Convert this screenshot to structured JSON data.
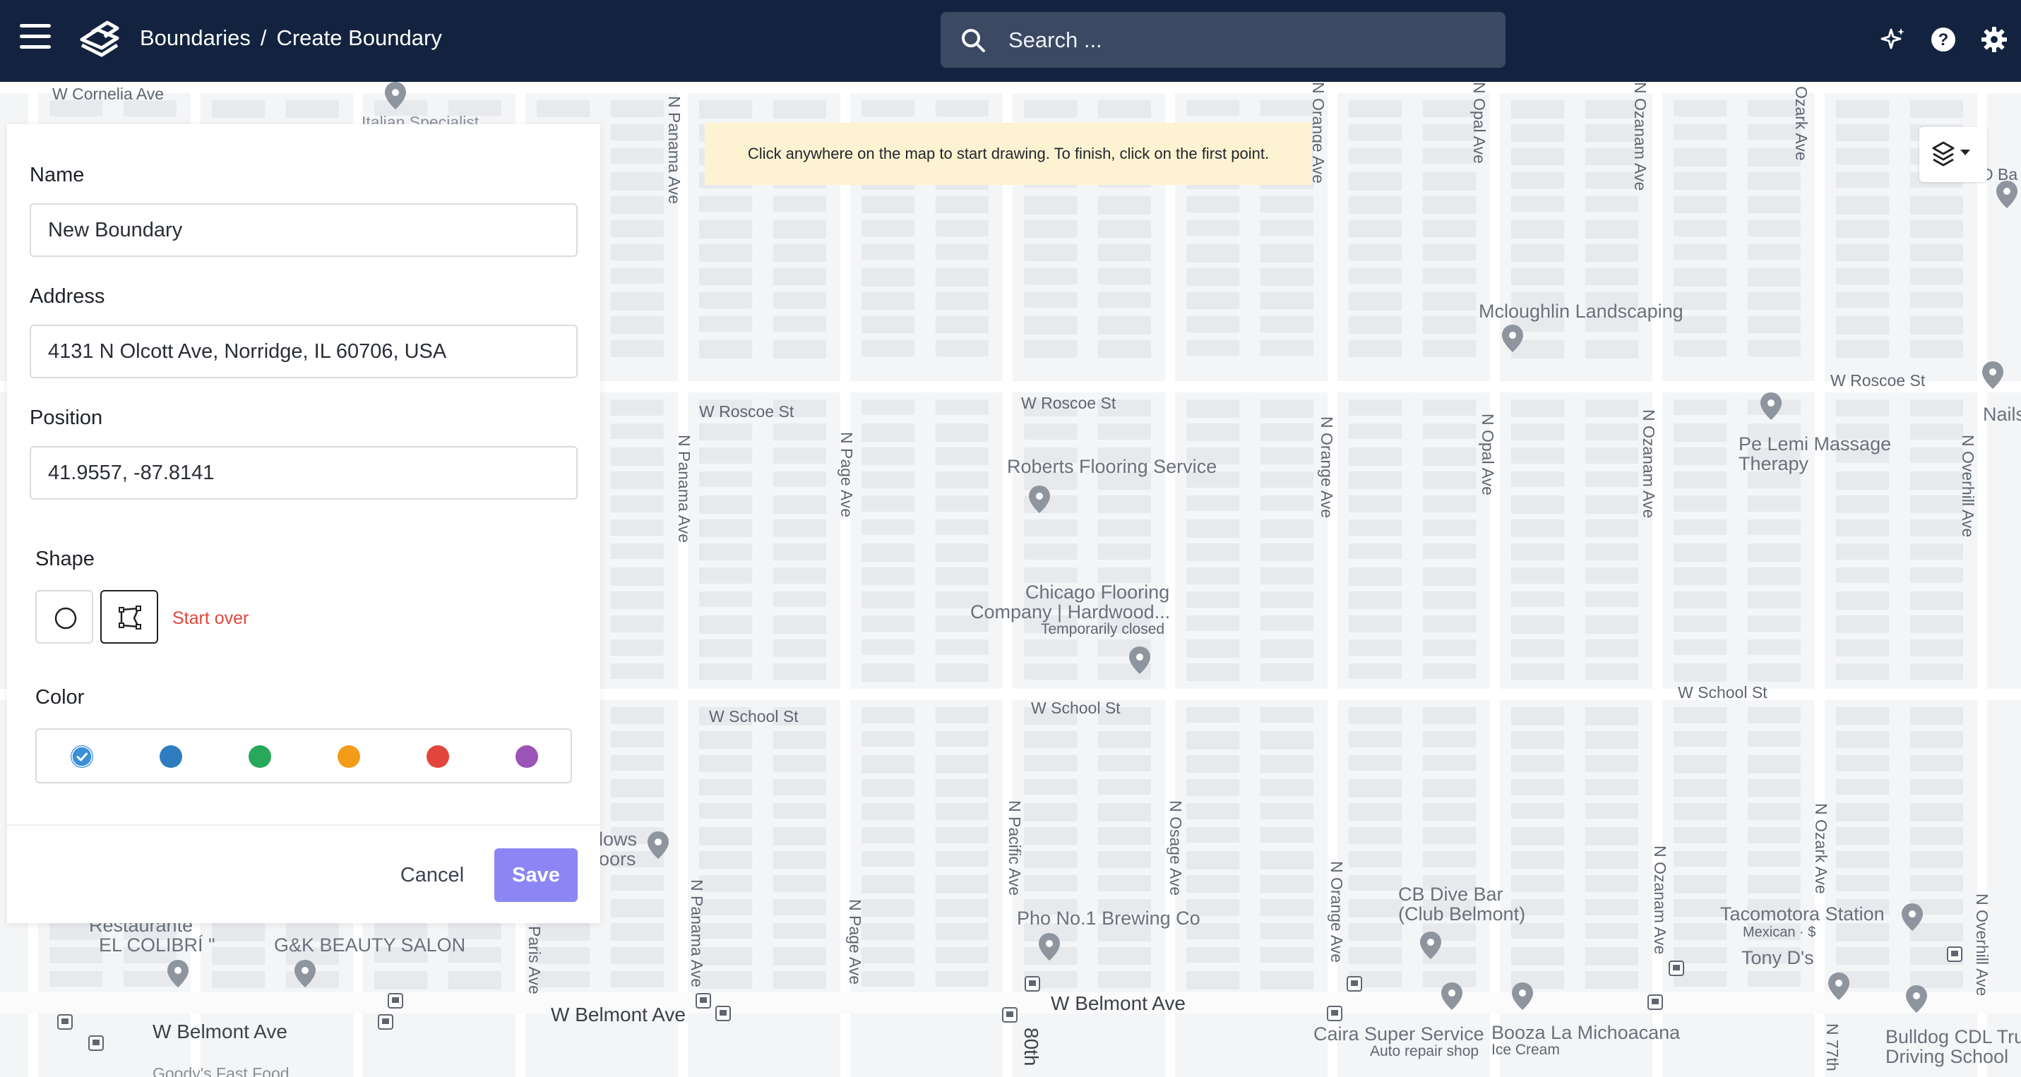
{
  "header": {
    "breadcrumb_parent": "Boundaries",
    "breadcrumb_separator": "/",
    "breadcrumb_current": "Create Boundary",
    "search_placeholder": "Search ..."
  },
  "icons": {
    "menu": "hamburger-menu-icon",
    "logo": "app-logo-icon",
    "search": "search-icon",
    "sparkle": "sparkle-icon",
    "help": "help-icon",
    "settings": "gear-icon",
    "layers": "layers-icon"
  },
  "map": {
    "hint": "Click anywhere on the map to start drawing. To finish, click on the first point.",
    "labels": {
      "w_cornelia": "W Cornelia Ave",
      "n_panama_1": "N Panama Ave",
      "n_orange_1": "N Orange Ave",
      "n_opal_1": "N Opal Ave",
      "n_ozanam_1": "N Ozanam Ave",
      "n_ozark_1": "Ozark Ave",
      "mcloughlin": "Mcloughlin Landscaping",
      "w_roscoe_1": "W Roscoe St",
      "w_roscoe_2": "W Roscoe St",
      "w_roscoe_3": "W Roscoe St",
      "n_panama_2": "N Panama Ave",
      "n_page_1": "N Page Ave",
      "n_orange_2": "N Orange Ave",
      "n_opal_2": "N Opal Ave",
      "n_ozanam_2": "N Ozanam Ave",
      "n_overhill_1": "N Overhill Ave",
      "roberts": "Roberts Flooring Service",
      "pe_lemi_1": "Pe Lemi Massage",
      "pe_lemi_2": "Therapy",
      "chicago_1": "Chicago Flooring",
      "chicago_2": "Company | Hardwood...",
      "chicago_3": "Temporarily closed",
      "w_school_1": "W School St",
      "w_school_2": "W School St",
      "w_school_3": "W School St",
      "n_pacific": "N Pacific Ave",
      "n_osage": "N Osage Ave",
      "n_orange_3": "N Orange Ave",
      "n_ozanam_3": "N Ozanam Ave",
      "n_ozark_2": "N Ozark Ave",
      "n_overhill_2": "N Overhill Ave",
      "n_panama_3": "N Panama Ave",
      "n_page_2": "N Page Ave",
      "paris": "Paris Ave",
      "cb_dive_1": "CB Dive Bar",
      "cb_dive_2": "(Club Belmont)",
      "tacomotora": "Tacomotora Station",
      "mexican": "Mexican · $",
      "tonys": "Tony D's",
      "pho": "Pho No.1 Brewing Co",
      "gk": "G&K BEAUTY SALON",
      "restaurante": "Restaurante",
      "colibri": "EL COLIBRÍ \"",
      "belmont_1": "W Belmont Ave",
      "belmont_2": "W Belmont Ave",
      "belmont_3": "W Belmont Ave",
      "caira": "Caira Super Service",
      "caira_sub": "Auto repair shop",
      "booza": "Booza La Michoacana",
      "booza_sub": "Ice Cream",
      "bulldog_1": "Bulldog CDL Tru",
      "bulldog_2": "Driving School",
      "lows": "lows",
      "oors": "oors",
      "nails": "Nails",
      "italian": "Italian Specialist",
      "n_77th": "N 77th",
      "eightieth": "80th",
      "goodys": "Goody's Fast Food",
      "ba": "D Ba"
    }
  },
  "form": {
    "name_label": "Name",
    "name_value": "New Boundary",
    "address_label": "Address",
    "address_value": "4131 N Olcott Ave, Norridge, IL 60706, USA",
    "position_label": "Position",
    "position_value": "41.9557, -87.8141",
    "shape_label": "Shape",
    "shapes": [
      "circle-shape-icon",
      "polygon-shape-icon"
    ],
    "selected_shape": "polygon",
    "start_over": "Start over",
    "color_label": "Color",
    "colors": [
      "#3b8fd8",
      "#2d7cc0",
      "#27a85a",
      "#f39c1a",
      "#e2453b",
      "#9b53b8"
    ],
    "selected_color": "#3b8fd8",
    "cancel": "Cancel",
    "save": "Save"
  }
}
